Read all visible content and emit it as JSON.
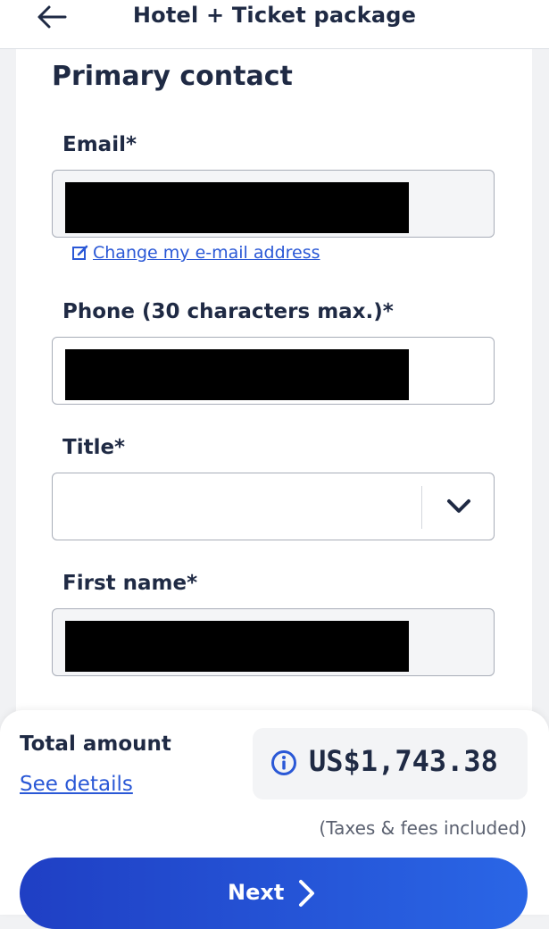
{
  "header": {
    "title": "Hotel + Ticket package",
    "back_icon": "arrow-left-icon"
  },
  "form": {
    "section_title": "Primary contact",
    "email": {
      "label": "Email*",
      "value": "",
      "redacted": true
    },
    "change_email_link": "Change my e-mail address",
    "phone": {
      "label": "Phone (30 characters max.)*",
      "value": "",
      "redacted": true
    },
    "title": {
      "label": "Title*",
      "value": ""
    },
    "first_name": {
      "label": "First name*",
      "value": "",
      "redacted": true
    }
  },
  "footer": {
    "total_label": "Total amount",
    "see_details": "See details",
    "price": "US$1,743.38",
    "taxes_note": "(Taxes & fees included)",
    "next_label": "Next"
  },
  "colors": {
    "primary": "#1f3fc4",
    "link": "#2a58d6",
    "text": "#1f2a44"
  }
}
